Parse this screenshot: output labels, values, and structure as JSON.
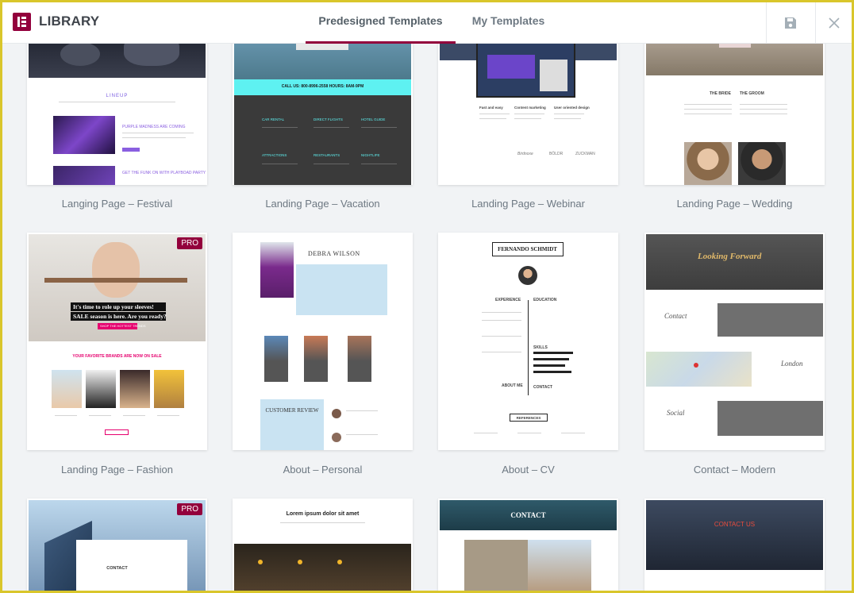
{
  "header": {
    "title": "LIBRARY",
    "tabs": [
      {
        "label": "Predesigned Templates",
        "active": true
      },
      {
        "label": "My Templates",
        "active": false
      }
    ],
    "save_icon": "save-icon",
    "close_icon": "close-icon"
  },
  "colors": {
    "accent": "#93003c",
    "frame": "#d9c62b"
  },
  "templates": [
    {
      "caption": "Langing Page – Festival",
      "pro": false
    },
    {
      "caption": "Landing Page – Vacation",
      "pro": false
    },
    {
      "caption": "Landing Page – Webinar",
      "pro": false
    },
    {
      "caption": "Landing Page – Wedding",
      "pro": false
    },
    {
      "caption": "Landing Page – Fashion",
      "pro": true
    },
    {
      "caption": "About – Personal",
      "pro": false
    },
    {
      "caption": "About – CV",
      "pro": false
    },
    {
      "caption": "Contact – Modern",
      "pro": false
    },
    {
      "caption": "",
      "pro": true
    },
    {
      "caption": "",
      "pro": false
    },
    {
      "caption": "",
      "pro": false
    },
    {
      "caption": "",
      "pro": false
    }
  ],
  "pro_label": "PRO",
  "previews": {
    "festival": {
      "heading": "LINEUP",
      "title1": "PURPLE MADNESS ARE COMING",
      "title2": "GET THE FUNK ON WITH PLAYBOAD PARTY"
    },
    "vacation": {
      "banner": "CALL US: 800-8996-2558 HOURS: 8AM-9PM",
      "items": [
        "CAR RENTAL",
        "DIRECT FLIGHTS",
        "HOTEL GUIDE",
        "ATTRACTIONS",
        "RESTAURANTS",
        "NIGHTLIFE"
      ]
    },
    "webinar": {
      "cols": [
        "Fast and easy",
        "Content marketing",
        "User oriented design"
      ],
      "logos": [
        "Birdnoxe",
        "BÖLDR",
        "ZUCKMAN"
      ]
    },
    "wedding": {
      "bride": "THE BRIDE",
      "groom": "THE GROOM"
    },
    "fashion": {
      "headline1": "It's time to role up your sleeves!",
      "headline2": "SALE season is here. Are you ready?",
      "cta": "SHOP THE HOTTEST TRENDS",
      "subhead": "YOUR FAVORITE BRANDS ARE NOW ON SALE"
    },
    "personal": {
      "name": "DEBRA WILSON",
      "review": "CUSTOMER REVIEW"
    },
    "cv": {
      "name": "FERNANDO SCHMIDT",
      "experience": "EXPERIENCE",
      "education": "EDUCATION",
      "skills": "SKILLS",
      "about": "ABOUT ME",
      "contact": "CONTACT",
      "references": "REFERENCES"
    },
    "modern": {
      "headline": "Looking Forward",
      "contact": "Contact",
      "london": "London",
      "social": "Social"
    },
    "row3": {
      "contact_b": "CONTACT",
      "lorem": "Lorem ipsum dolor sit amet",
      "contact_c": "CONTACT",
      "contact_d": "CONTACT US"
    }
  }
}
